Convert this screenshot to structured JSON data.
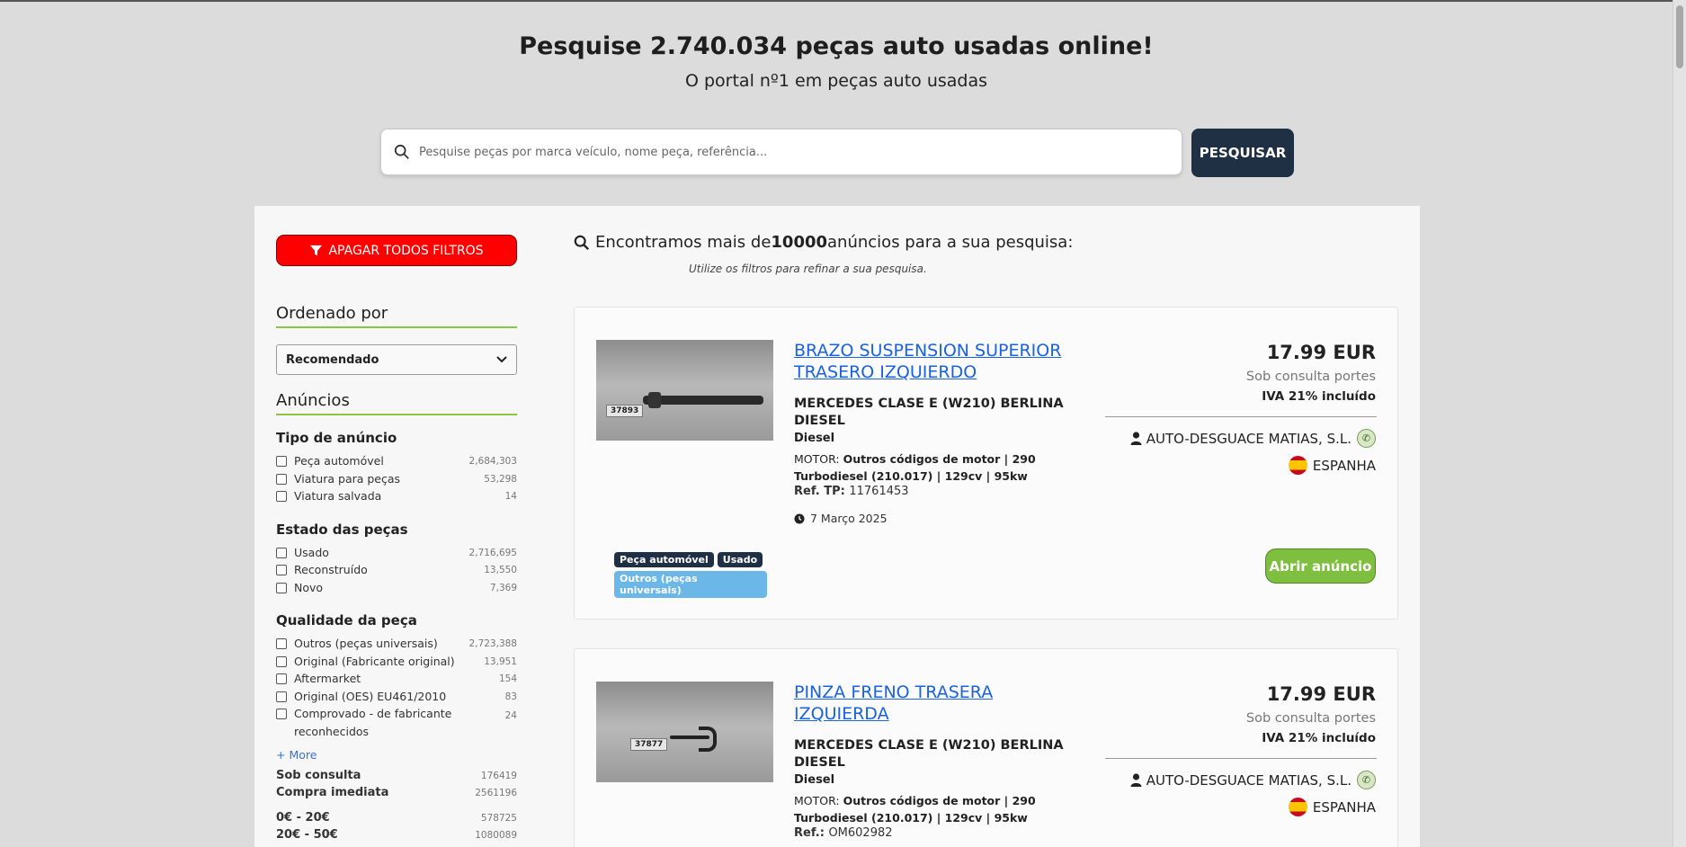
{
  "hero": {
    "title_prefix": "Pesquise ",
    "title_count": "2.740.034",
    "title_suffix": " peças auto usadas online!",
    "subtitle": "O portal nº1 em peças auto usadas"
  },
  "search": {
    "placeholder": "Pesquise peças por marca veículo, nome peça, referência...",
    "button_label": "PESQUISAR"
  },
  "sidebar": {
    "clear_filters": "APAGAR TODOS FILTROS",
    "sort_title": "Ordenado por",
    "sort_selected": "Recomendado",
    "ads_title": "Anúncios",
    "groups": [
      {
        "title": "Tipo de anúncio",
        "options": [
          {
            "label": "Peça automóvel",
            "count": "2,684,303"
          },
          {
            "label": "Viatura para peças",
            "count": "53,298"
          },
          {
            "label": "Viatura salvada",
            "count": "14"
          }
        ]
      },
      {
        "title": "Estado das peças",
        "options": [
          {
            "label": "Usado",
            "count": "2,716,695"
          },
          {
            "label": "Reconstruído",
            "count": "13,550"
          },
          {
            "label": "Novo",
            "count": "7,369"
          }
        ]
      },
      {
        "title": "Qualidade da peça",
        "options": [
          {
            "label": "Outros (peças universais)",
            "count": "2,723,388"
          },
          {
            "label": "Original (Fabricante original)",
            "count": "13,951"
          },
          {
            "label": "Aftermarket",
            "count": "154"
          },
          {
            "label": "Original (OES) EU461/2010",
            "count": "83"
          },
          {
            "label": "Comprovado - de fabricante reconhecidos",
            "count": "24"
          }
        ]
      }
    ],
    "more_label": "+ More",
    "stats": [
      {
        "label": "Sob consulta",
        "count": "176419"
      },
      {
        "label": "Compra imediata",
        "count": "2561196"
      }
    ],
    "price_ranges": [
      {
        "label": "0€ - 20€",
        "count": "578725"
      },
      {
        "label": "20€ - 50€",
        "count": "1080089"
      }
    ]
  },
  "results": {
    "heading_prefix": "Encontramos mais de ",
    "heading_count": "10000",
    "heading_suffix": " anúncios para a sua pesquisa:",
    "subheading": "Utilize os filtros para refinar a sua pesquisa."
  },
  "listings": [
    {
      "thumb_tag": "37893",
      "title": "BRAZO SUSPENSION SUPERIOR TRASERO IZQUIERDO",
      "model": "MERCEDES CLASE E (W210) BERLINA DIESEL",
      "fuel": "Diesel",
      "motor_label": "MOTOR: ",
      "motor_value": "Outros códigos de motor | 290 Turbodiesel (210.017) | 129cv | 95kw",
      "ref_label": "Ref. TP: ",
      "ref_value": "11761453",
      "date": "7 Março 2025",
      "price": "17.99 EUR",
      "shipping": "Sob consulta portes",
      "vat": "IVA 21% incluído",
      "seller": "AUTO-DESGUACE MATIAS, S.L.",
      "country": "ESPANHA",
      "badges": [
        "Peça automóvel",
        "Usado",
        "Outros (peças universais)"
      ],
      "open_label": "Abrir anúncio"
    },
    {
      "thumb_tag": "37877",
      "title": "PINZA FRENO TRASERA IZQUIERDA",
      "model": "MERCEDES CLASE E (W210) BERLINA DIESEL",
      "fuel": "Diesel",
      "motor_label": "MOTOR: ",
      "motor_value": "Outros códigos de motor | 290 Turbodiesel (210.017) | 129cv | 95kw",
      "ref_label": "Ref.: ",
      "ref_value": "OM602982",
      "price": "17.99 EUR",
      "shipping": "Sob consulta portes",
      "vat": "IVA 21% incluído",
      "seller": "AUTO-DESGUACE MATIAS, S.L.",
      "country": "ESPANHA"
    }
  ]
}
